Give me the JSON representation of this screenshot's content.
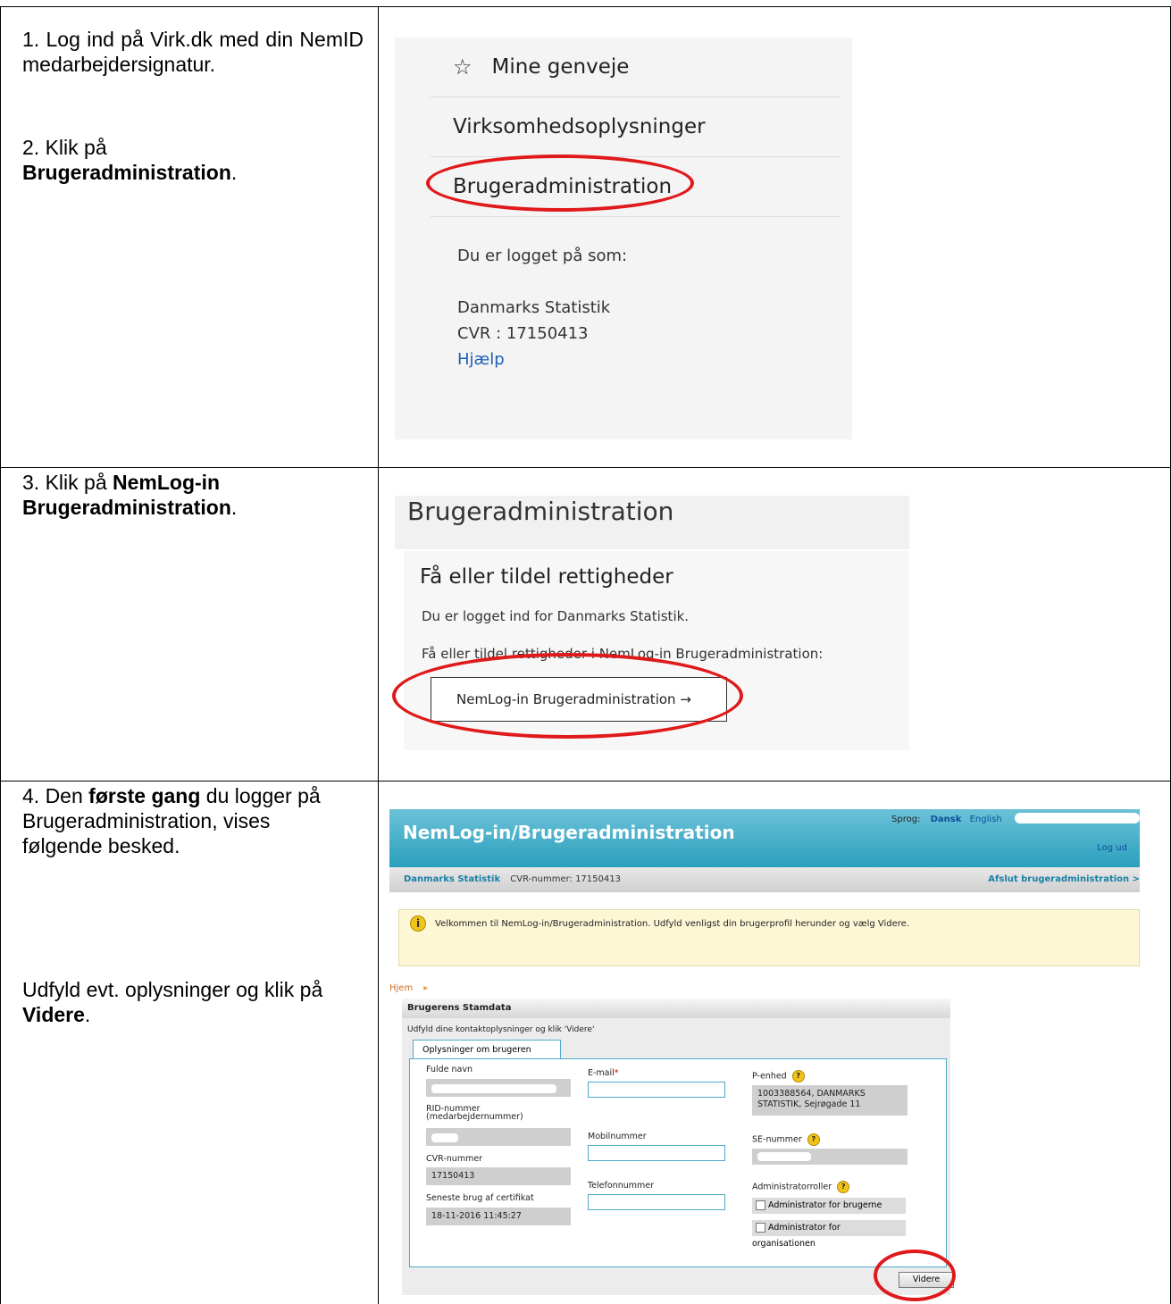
{
  "instructions": {
    "step1": "1. Log ind på Virk.dk med din NemID medarbejdersignatur.",
    "step2_pre": "2. Klik på",
    "step2_bold": "Brugeradministration",
    "step2_post": ".",
    "step3_pre": "3. Klik på",
    "step3_bold": "NemLog-in Brugeradministration",
    "step3_post": ".",
    "step4_pre": "4. Den",
    "step4_bold": "første gang",
    "step4_post": "du logger på Brugeradministration, vises følgende besked.",
    "step5_pre": "Udfyld evt. oplysninger og klik på",
    "step5_bold": "Videre",
    "step5_post": "."
  },
  "virk_menu": {
    "items": [
      "Mine genveje",
      "Virksomhedsoplysninger",
      "Brugeradministration"
    ],
    "logged_in_as": "Du er logget på som:",
    "company": "Danmarks Statistik",
    "cvr": "CVR : 17150413",
    "help": "Hjælp"
  },
  "bruger_panel": {
    "header": "Brugeradministration",
    "heading": "Få eller tildel rettigheder",
    "line1": "Du er logget ind for Danmarks Statistik.",
    "line2": "Få eller tildel rettigheder i NemLog-in Brugeradministration:",
    "button": "NemLog-in Brugeradministration →"
  },
  "nemlogin": {
    "title": "NemLog-in/Brugeradministration",
    "sprog_label": "Sprog:",
    "dansk": "Dansk",
    "english": "English",
    "logout": "Log ud",
    "org": "Danmarks Statistik",
    "cvr_label": "CVR-nummer: 17150413",
    "exit": "Afslut brugeradministration >",
    "welcome": "Velkommen til NemLog-in/Brugeradministration. Udfyld venligst din brugerprofil herunder og vælg Videre.",
    "crumb": "Hjem",
    "section_title": "Brugerens Stamdata",
    "section_text": "Udfyld dine kontaktoplysninger og klik 'Videre'",
    "tab": "Oplysninger om brugeren",
    "fields": {
      "full_name": "Fulde navn",
      "rid": "RID-nummer (medarbejdernummer)",
      "cvr": "CVR-nummer",
      "cvr_value": "17150413",
      "last_use": "Seneste brug af certifikat",
      "last_use_value": "18-11-2016 11:45:27",
      "email": "E-mail",
      "email_required": "*",
      "mobile": "Mobilnummer",
      "phone": "Telefonnummer",
      "p_unit": "P-enhed",
      "p_unit_value": "1003388564, DANMARKS STATISTIK, Sejrøgade 11",
      "se": "SE-nummer",
      "admin_roles": "Administratorroller",
      "admin_users": "Administrator for brugerne",
      "admin_org": "Administrator for organisationen"
    },
    "next_button": "Videre"
  }
}
